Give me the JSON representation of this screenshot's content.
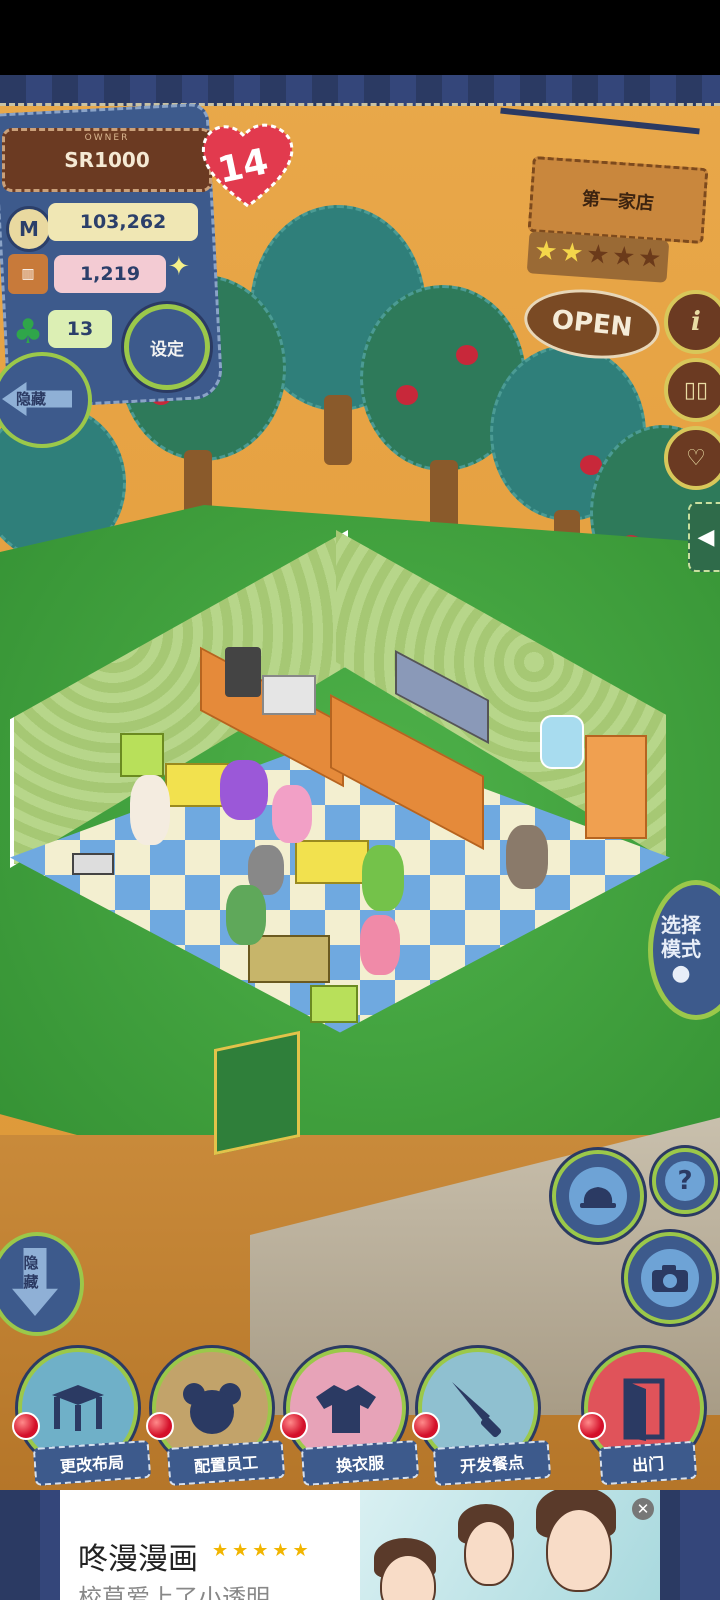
{
  "owner": {
    "tag": "OWNER",
    "name": "SR1000"
  },
  "level": "14",
  "stats": {
    "money": "103,262",
    "ingredients": "1,219",
    "clover": "13"
  },
  "buttons": {
    "settings": "设定",
    "hide_top": "隐藏",
    "hide_bottom": "隐藏"
  },
  "shop": {
    "name": "第一家店",
    "stars_filled": 2,
    "stars_total": 5,
    "status": "OPEN"
  },
  "side_icons": {
    "info": "i",
    "book": "book-icon",
    "love": "heart-speech-icon"
  },
  "mode": {
    "label_line1": "选择",
    "label_line2": "模式"
  },
  "controls": {
    "help": "?",
    "hat": "hat-icon",
    "camera": "camera-icon"
  },
  "menu": [
    {
      "label": "更改布局",
      "icon": "table-icon"
    },
    {
      "label": "配置员工",
      "icon": "bear-icon"
    },
    {
      "label": "换衣服",
      "icon": "shirt-icon"
    },
    {
      "label": "开发餐点",
      "icon": "knife-icon"
    },
    {
      "label": "出门",
      "icon": "door-icon"
    }
  ],
  "ad": {
    "title": "咚漫漫画",
    "rating": "★★★★★",
    "subtitle": "校草爱上了小透明…"
  },
  "colors": {
    "denim": "#3d5a8c",
    "ring": "#9bc84a",
    "heart": "#e23a4e",
    "wood": "#6b3a22"
  }
}
